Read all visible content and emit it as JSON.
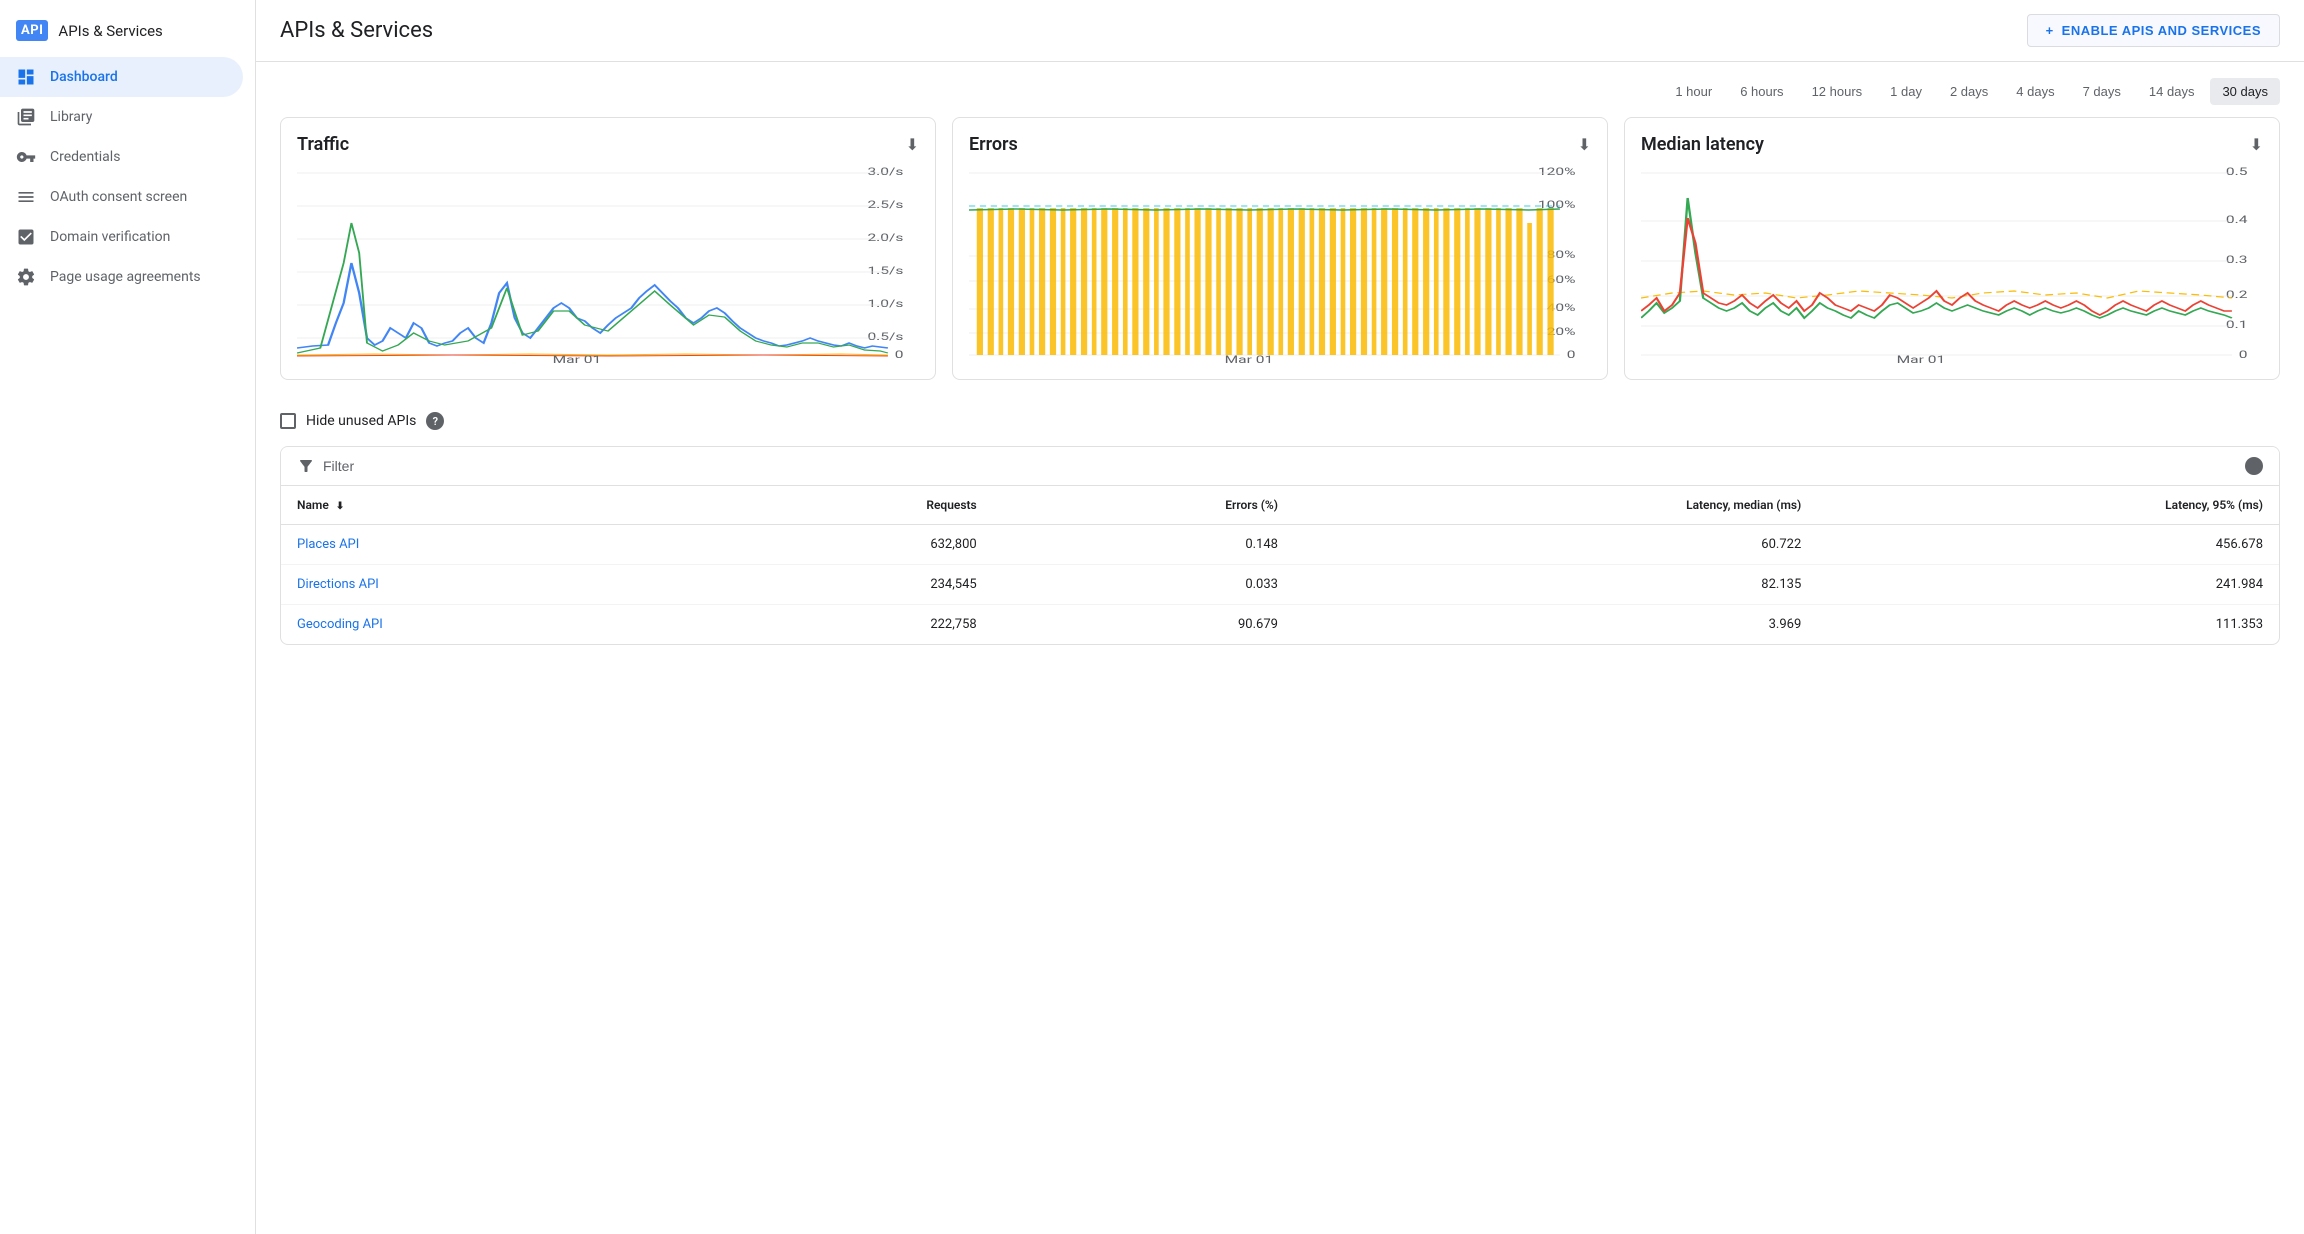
{
  "sidebar": {
    "logo_text": "API",
    "title": "APIs & Services",
    "items": [
      {
        "id": "dashboard",
        "label": "Dashboard",
        "icon": "◈",
        "active": true
      },
      {
        "id": "library",
        "label": "Library",
        "icon": "▦",
        "active": false
      },
      {
        "id": "credentials",
        "label": "Credentials",
        "icon": "⚿",
        "active": false
      },
      {
        "id": "oauth",
        "label": "OAuth consent screen",
        "icon": "≡",
        "active": false
      },
      {
        "id": "domain",
        "label": "Domain verification",
        "icon": "☑",
        "active": false
      },
      {
        "id": "page-usage",
        "label": "Page usage agreements",
        "icon": "⚙",
        "active": false
      }
    ]
  },
  "header": {
    "title": "APIs & Services",
    "enable_btn": "ENABLE APIS AND SERVICES"
  },
  "time_selector": {
    "options": [
      "1 hour",
      "6 hours",
      "12 hours",
      "1 day",
      "2 days",
      "4 days",
      "7 days",
      "14 days",
      "30 days"
    ],
    "active": "30 days"
  },
  "charts": {
    "traffic": {
      "title": "Traffic",
      "x_label": "Mar 01"
    },
    "errors": {
      "title": "Errors",
      "x_label": "Mar 01"
    },
    "latency": {
      "title": "Median latency",
      "x_label": "Mar 01"
    }
  },
  "filter_section": {
    "hide_unused_label": "Hide unused APIs",
    "filter_label": "Filter"
  },
  "table": {
    "columns": [
      {
        "id": "name",
        "label": "Name",
        "sortable": true
      },
      {
        "id": "requests",
        "label": "Requests",
        "sortable": true
      },
      {
        "id": "errors",
        "label": "Errors (%)",
        "sortable": false
      },
      {
        "id": "latency_median",
        "label": "Latency, median (ms)",
        "sortable": false
      },
      {
        "id": "latency_95",
        "label": "Latency, 95% (ms)",
        "sortable": false
      }
    ],
    "rows": [
      {
        "name": "Places API",
        "requests": "632,800",
        "errors": "0.148",
        "latency_median": "60.722",
        "latency_95": "456.678"
      },
      {
        "name": "Directions API",
        "requests": "234,545",
        "errors": "0.033",
        "latency_median": "82.135",
        "latency_95": "241.984"
      },
      {
        "name": "Geocoding API",
        "requests": "222,758",
        "errors": "90.679",
        "latency_median": "3.969",
        "latency_95": "111.353"
      }
    ]
  },
  "colors": {
    "blue": "#1a73e8",
    "active_bg": "#e8f0fe",
    "border": "#e0e0e0",
    "chart_blue": "#4285f4",
    "chart_green": "#34a853",
    "chart_orange": "#fbbc04",
    "chart_red": "#ea4335",
    "chart_teal": "#00bcd4"
  }
}
